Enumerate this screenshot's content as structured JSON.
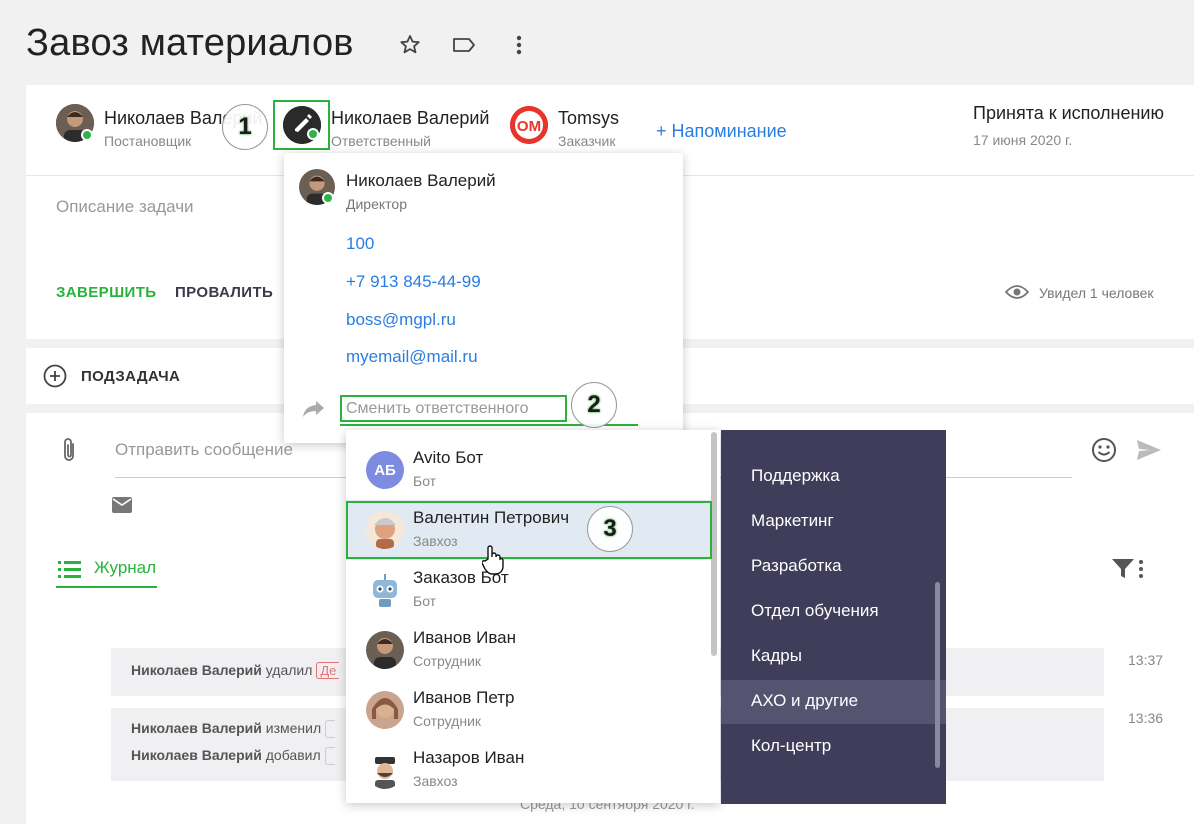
{
  "page": {
    "title": "Завоз материалов"
  },
  "participants": {
    "creator": {
      "name": "Николаев Валерий",
      "role": "Постановщик"
    },
    "responsible": {
      "name": "Николаев Валерий",
      "role": "Ответственный"
    },
    "customer": {
      "name": "Tomsys",
      "role": "Заказчик"
    },
    "reminder_label": "+ Напоминание"
  },
  "status": {
    "text": "Принята к исполнению",
    "date": "17 июня 2020 г."
  },
  "description": {
    "placeholder": "Описание задачи"
  },
  "actions": {
    "complete": "ЗАВЕРШИТЬ",
    "fail": "ПРОВАЛИТЬ"
  },
  "seen": {
    "text": "Увидел 1 человек"
  },
  "subtask": {
    "label": "ПОДЗАДАЧА"
  },
  "message": {
    "placeholder": "Отправить сообщение"
  },
  "journal": {
    "label": "Журнал"
  },
  "log": {
    "rows": [
      {
        "author": "Николаев Валерий",
        "action": "удалил",
        "badge": "Де",
        "time": "13:37"
      },
      {
        "author": "Николаев Валерий",
        "action": "изменил",
        "time": "13:36"
      },
      {
        "author": "Николаев Валерий",
        "action": "добавил"
      }
    ],
    "date_divider": "Среда, 10 сентября 2020 г."
  },
  "profile_popup": {
    "name": "Николаев Валерий",
    "position": "Директор",
    "contacts": [
      "100",
      "+7 913 845-44-99",
      "boss@mgpl.ru",
      "myemail@mail.ru"
    ],
    "change_placeholder": "Сменить ответственного"
  },
  "user_list": [
    {
      "name": "Avito Бот",
      "role": "Бот",
      "initials": "АБ"
    },
    {
      "name": "Валентин Петрович",
      "role": "Завхоз"
    },
    {
      "name": "Заказов Бот",
      "role": "Бот"
    },
    {
      "name": "Иванов Иван",
      "role": "Сотрудник"
    },
    {
      "name": "Иванов Петр",
      "role": "Сотрудник"
    },
    {
      "name": "Назаров Иван",
      "role": "Завхоз"
    }
  ],
  "departments": [
    "Поддержка",
    "Маркетинг",
    "Разработка",
    "Отдел обучения",
    "Кадры",
    "АХО и другие",
    "Кол-центр"
  ],
  "annotations": [
    "1",
    "2",
    "3"
  ],
  "customer_logo_text": "OM",
  "colors": {
    "accent": "#2a7de1",
    "green": "#29b33c",
    "dept_bg": "#3f3d5a",
    "dept_active": "#55536f"
  }
}
